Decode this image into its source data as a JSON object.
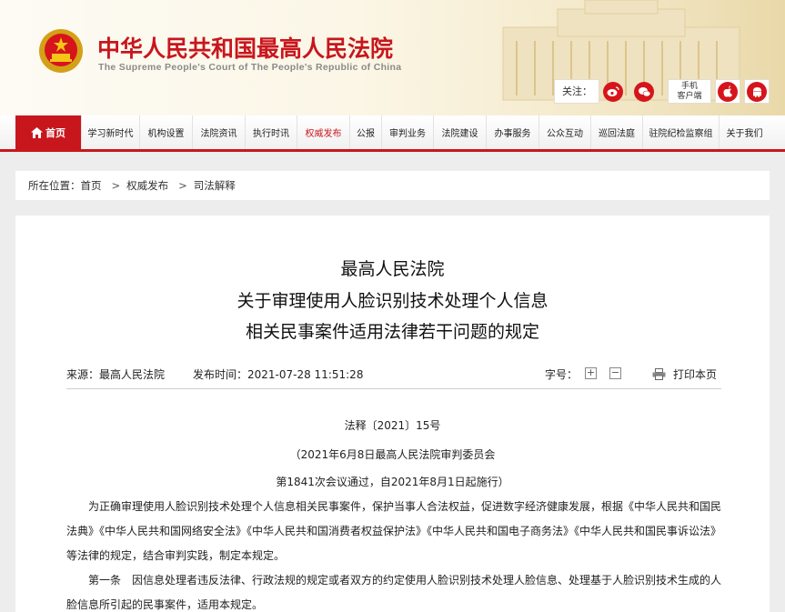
{
  "header": {
    "title": "中华人民共和国最高人民法院",
    "subtitle": "The Supreme People's Court of The People's Republic of China",
    "follow_label": "关注：",
    "mobile_label_line1": "手机",
    "mobile_label_line2": "客户端",
    "icons": [
      "weibo-icon",
      "wechat-icon",
      "apple-icon",
      "android-icon"
    ]
  },
  "nav": {
    "home": "首页",
    "items": [
      "学习新时代",
      "机构设置",
      "法院资讯",
      "执行时讯",
      "权威发布",
      "公报",
      "审判业务",
      "法院建设",
      "办事服务",
      "公众互动",
      "巡回法庭",
      "驻院纪检监察组",
      "关于我们"
    ],
    "active_index": 4
  },
  "breadcrumb": {
    "prefix": "所在位置：",
    "items": [
      "首页",
      "权威发布",
      "司法解释"
    ],
    "separator": ">"
  },
  "article": {
    "title_lines": [
      "最高人民法院",
      "关于审理使用人脸识别技术处理个人信息",
      "相关民事案件适用法律若干问题的规定"
    ],
    "source": "来源：最高人民法院",
    "publish_time": "发布时间：2021-07-28 11:51:28",
    "font_size_label": "字号：",
    "font_plus": "+",
    "font_minus": "−",
    "print_label": "打印本页",
    "doc_number": "法释〔2021〕15号",
    "adopted_line1": "（2021年6月8日最高人民法院审判委员会",
    "adopted_line2": "第1841次会议通过，自2021年8月1日起施行）",
    "para1": "为正确审理使用人脸识别技术处理个人信息相关民事案件，保护当事人合法权益，促进数字经济健康发展，根据《中华人民共和国民法典》《中华人民共和国网络安全法》《中华人民共和国消费者权益保护法》《中华人民共和国电子商务法》《中华人民共和国民事诉讼法》等法律的规定，结合审判实践，制定本规定。",
    "para2": "第一条　因信息处理者违反法律、行政法规的规定或者双方的约定使用人脸识别技术处理人脸信息、处理基于人脸识别技术生成的人脸信息所引起的民事案件，适用本规定。"
  },
  "colors": {
    "brand_red": "#c8161d",
    "background": "#ededed"
  }
}
